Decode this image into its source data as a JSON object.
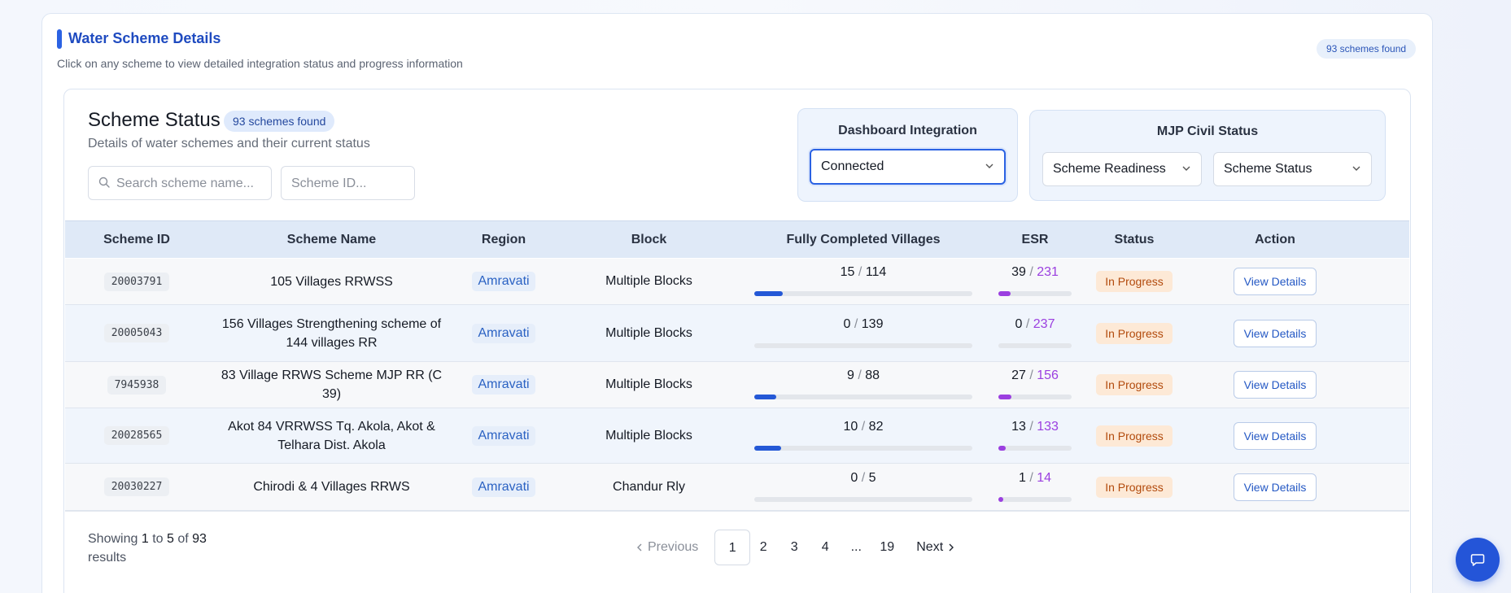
{
  "section": {
    "title": "Water Scheme Details",
    "subtitle": "Click on any scheme to view detailed integration status and progress information",
    "badge": "93 schemes found"
  },
  "header": {
    "title": "Scheme Status",
    "badge": "93 schemes found",
    "subtitle": "Details of water schemes and their current status"
  },
  "search": {
    "name_placeholder": "Search scheme name...",
    "id_placeholder": "Scheme ID..."
  },
  "filters": {
    "dashboard_integration": {
      "title": "Dashboard Integration",
      "selected": "Connected"
    },
    "mjp_civil_status": {
      "title": "MJP Civil Status",
      "readiness": "Scheme Readiness",
      "status": "Scheme Status"
    }
  },
  "table": {
    "columns": [
      "Scheme ID",
      "Scheme Name",
      "Region",
      "Block",
      "Fully Completed Villages",
      "ESR",
      "Status",
      "Action"
    ],
    "rows": [
      {
        "id": "20003791",
        "name": "105 Villages RRWSS",
        "region": "Amravati",
        "block": "Multiple Blocks",
        "villages_done": "15",
        "villages_total": "114",
        "esr_done": "39",
        "esr_total": "231",
        "status": "In Progress",
        "action": "View Details"
      },
      {
        "id": "20005043",
        "name": "156 Villages Strengthening scheme of 144 villages RR",
        "region": "Amravati",
        "block": "Multiple Blocks",
        "villages_done": "0",
        "villages_total": "139",
        "esr_done": "0",
        "esr_total": "237",
        "status": "In Progress",
        "action": "View Details"
      },
      {
        "id": "7945938",
        "name": "83 Village RRWS Scheme MJP RR (C 39)",
        "region": "Amravati",
        "block": "Multiple Blocks",
        "villages_done": "9",
        "villages_total": "88",
        "esr_done": "27",
        "esr_total": "156",
        "status": "In Progress",
        "action": "View Details"
      },
      {
        "id": "20028565",
        "name": "Akot 84 VRRWSS Tq. Akola, Akot & Telhara Dist. Akola",
        "region": "Amravati",
        "block": "Multiple Blocks",
        "villages_done": "10",
        "villages_total": "82",
        "esr_done": "13",
        "esr_total": "133",
        "status": "In Progress",
        "action": "View Details"
      },
      {
        "id": "20030227",
        "name": "Chirodi & 4 Villages RRWS",
        "region": "Amravati",
        "block": "Chandur Rly",
        "villages_done": "0",
        "villages_total": "5",
        "esr_done": "1",
        "esr_total": "14",
        "status": "In Progress",
        "action": "View Details"
      }
    ]
  },
  "footer": {
    "showing_prefix": "Showing",
    "from": "1",
    "to_word": "to",
    "to": "5",
    "of_word": "of",
    "total": "93",
    "results_word": "results",
    "previous": "Previous",
    "next": "Next",
    "pages": [
      "1",
      "2",
      "3",
      "4",
      "...",
      "19"
    ],
    "active_page": "1"
  },
  "colors": {
    "accent": "#2b62e3",
    "progress_villages": "#2458d6",
    "progress_esr": "#9b3fe0",
    "status_in_progress_bg": "#fde9d6",
    "status_in_progress_text": "#b24a0c"
  },
  "icons": {
    "search": "search-icon",
    "chevron": "chevron-down-icon",
    "chat": "chat-icon"
  }
}
